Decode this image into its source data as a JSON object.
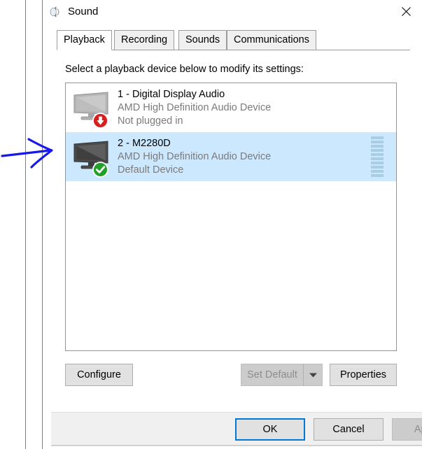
{
  "window": {
    "title": "Sound",
    "icon": "speaker-icon",
    "close_label": "✕"
  },
  "tabs": [
    {
      "label": "Playback",
      "active": true
    },
    {
      "label": "Recording",
      "active": false
    },
    {
      "label": "Sounds",
      "active": false
    },
    {
      "label": "Communications",
      "active": false
    }
  ],
  "main": {
    "instruction": "Select a playback device below to modify its settings:",
    "devices": [
      {
        "name": "1 - Digital Display Audio",
        "description": "AMD High Definition Audio Device",
        "status": "Not plugged in",
        "selected": false,
        "badge": "red-down-arrow-badge",
        "icon": "monitor-icon-grey",
        "meter_segments": 0
      },
      {
        "name": "2 - M2280D",
        "description": "AMD High Definition Audio Device",
        "status": "Default Device",
        "selected": true,
        "badge": "green-check-badge",
        "icon": "monitor-icon-dark",
        "meter_segments": 10
      }
    ]
  },
  "actions": {
    "configure": "Configure",
    "set_default": "Set Default",
    "set_default_enabled": false,
    "properties": "Properties"
  },
  "footer": {
    "ok": "OK",
    "cancel": "Cancel",
    "apply": "Apply",
    "apply_enabled": false
  },
  "colors": {
    "selection": "#cce8ff",
    "focus_border": "#0078d7",
    "meter": "#a8cde4",
    "badge_green": "#22a02a",
    "badge_red": "#d81f1f",
    "annotation": "#1818e8"
  },
  "annotation": {
    "shape": "hand-drawn-arrow",
    "direction": "right"
  }
}
